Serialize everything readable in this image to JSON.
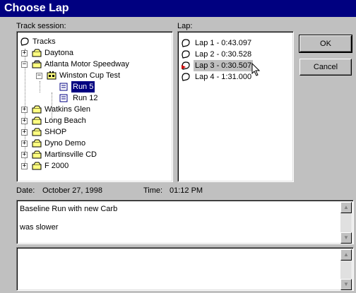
{
  "window": {
    "title": "Choose Lap"
  },
  "labels": {
    "track_session": "Track session:",
    "lap": "Lap:",
    "date_label": "Date:",
    "date_value": "October 27, 1998",
    "time_label": "Time:",
    "time_value": "01:12 PM"
  },
  "buttons": {
    "ok": "OK",
    "cancel": "Cancel"
  },
  "tree": {
    "root": "Tracks",
    "tracks": [
      "Daytona",
      "Atlanta Motor Speedway",
      "Watkins Glen",
      "Long Beach",
      "SHOP",
      "Dyno Demo",
      "Martinsville CD",
      "F 2000"
    ],
    "session": "Winston Cup Test",
    "runs": [
      "Run 5",
      "Run 12"
    ],
    "selected_run": "Run 5"
  },
  "laps": [
    {
      "label": "Lap 1 - 0:43.097"
    },
    {
      "label": "Lap 2 - 0:30.528"
    },
    {
      "label": "Lap 3 - 0:30.507"
    },
    {
      "label": "Lap 4 - 1:31.000"
    }
  ],
  "notes": {
    "line1": "Baseline Run with new Carb",
    "line2": "was slower"
  },
  "colors": {
    "titlebar": "#000080",
    "selection": "#000080",
    "lap3_icon": "#d00000"
  },
  "icons": {
    "tree_root": "track-icon",
    "track": "folder-car-icon",
    "session": "session-flag-icon",
    "run": "run-doc-icon",
    "lap": "lap-icon"
  }
}
